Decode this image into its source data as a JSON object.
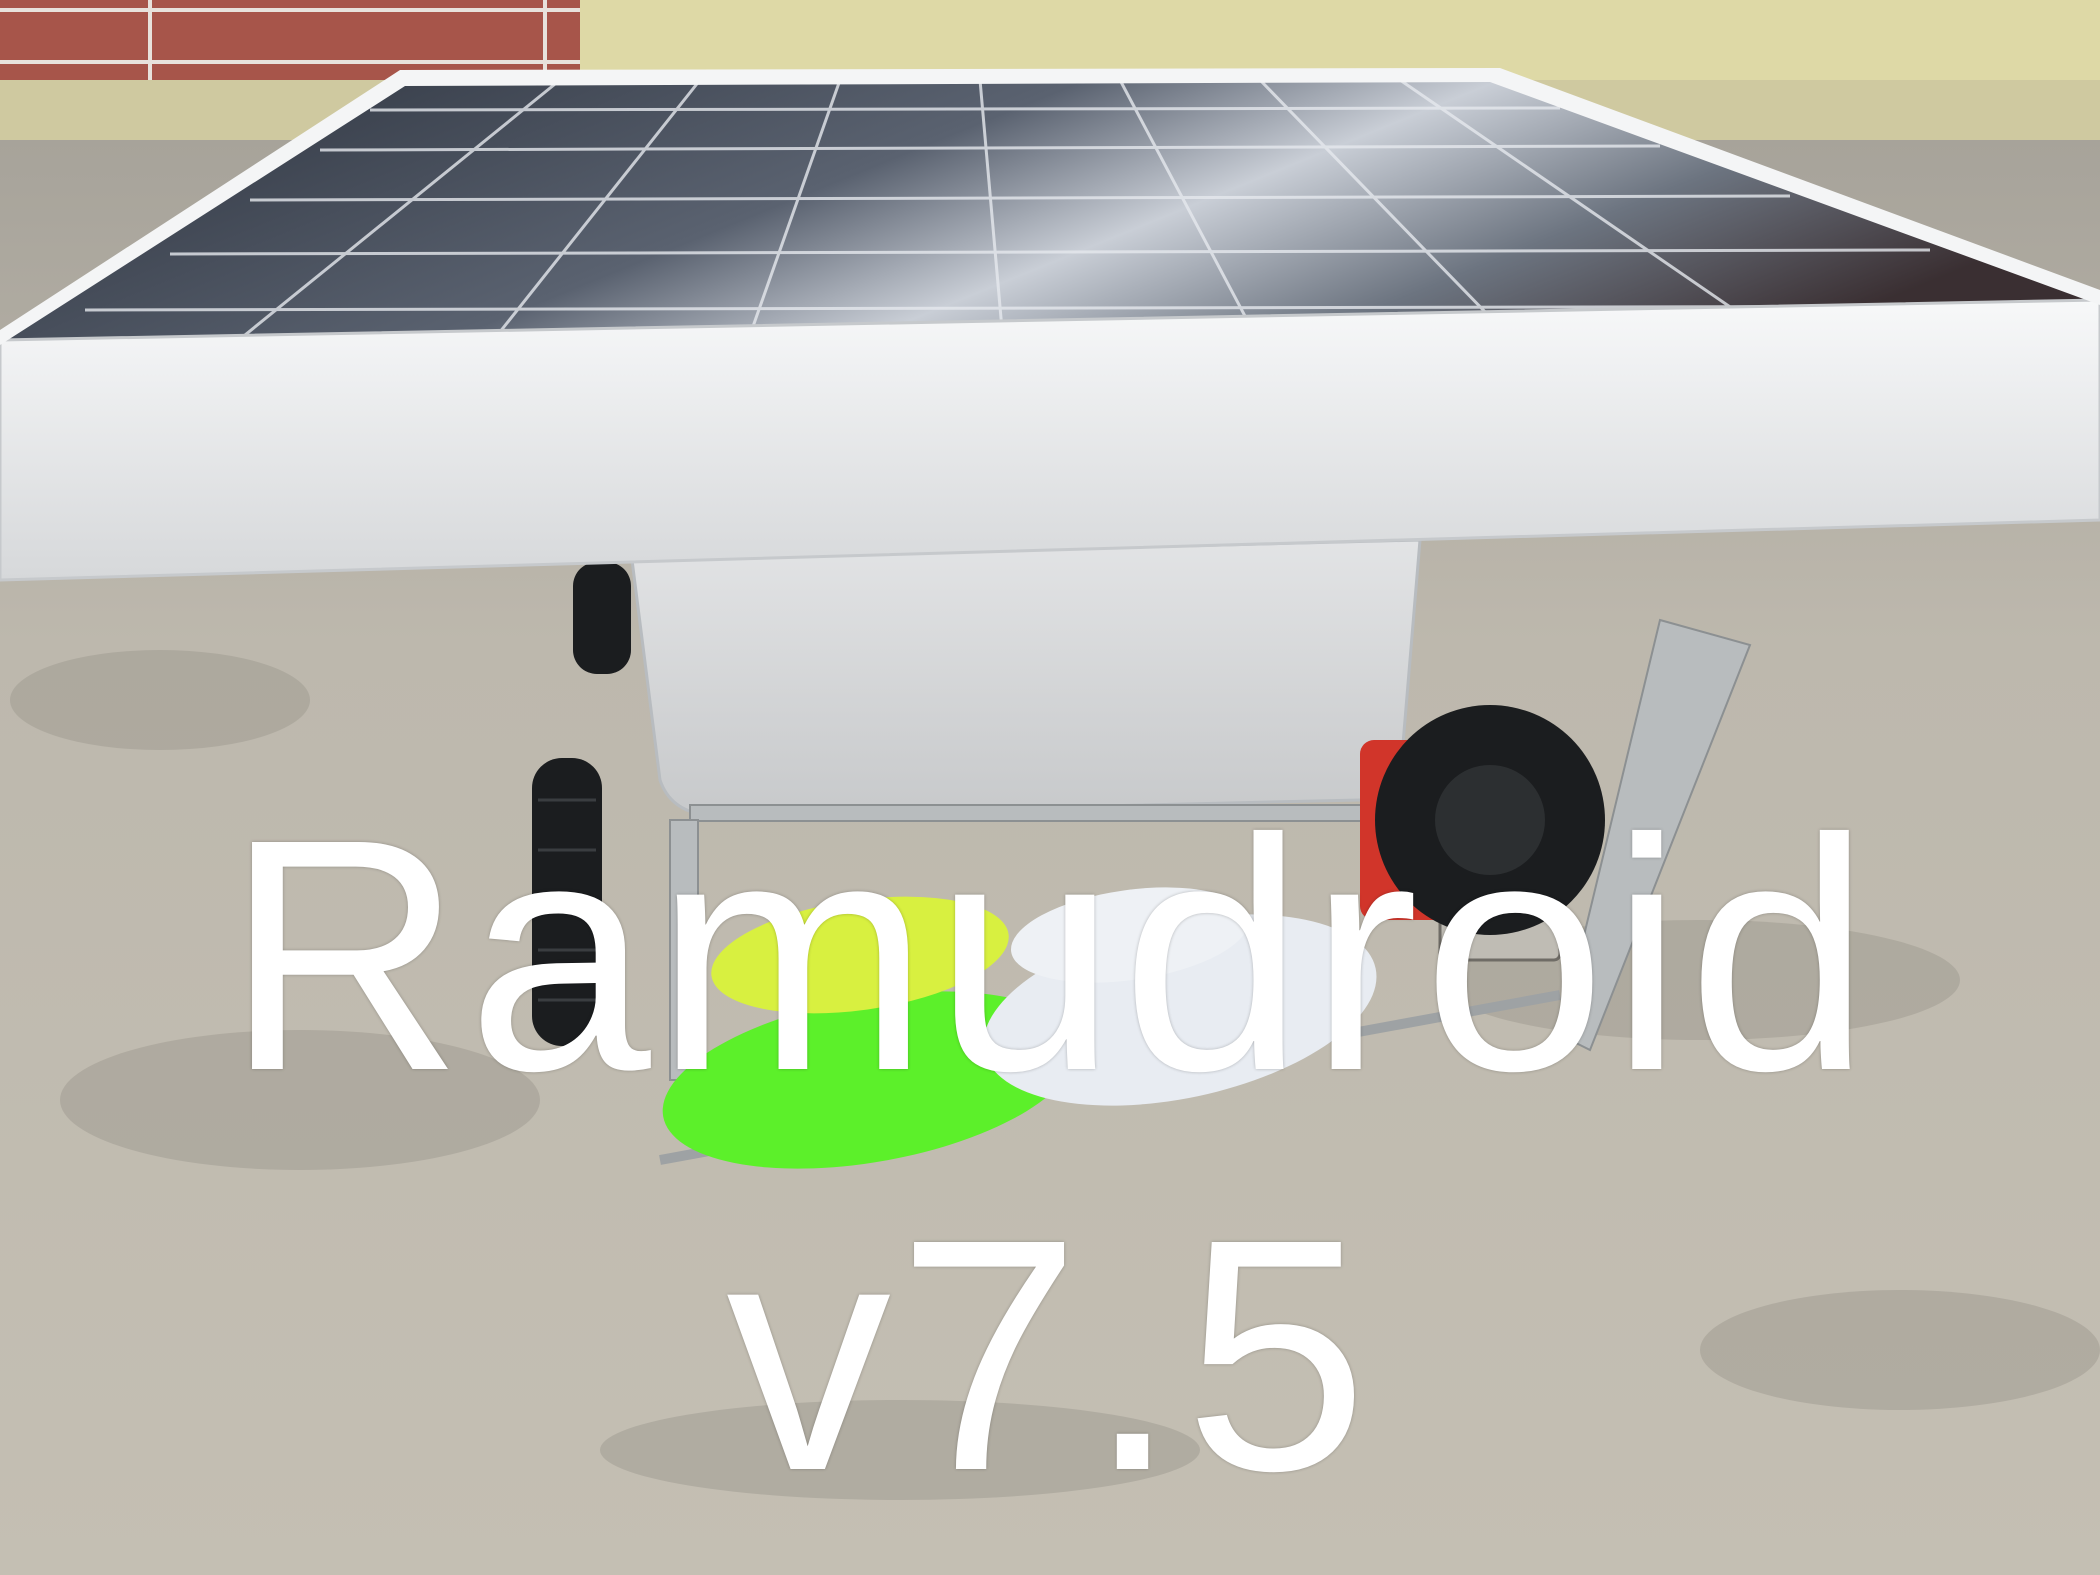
{
  "caption": {
    "line1": "Ramudroid",
    "line2": "v7.5"
  },
  "colors": {
    "ground": "#b9b4a8",
    "wall": "#ded9a6",
    "panel_cell": "#1f2530",
    "panel_frame": "#eceef0",
    "brush_green": "#5cf02a",
    "brush_yellow": "#d8f040",
    "brush_white": "#e8ecf2",
    "tire": "#1b1d1f",
    "caption": "#ffffff"
  },
  "image": {
    "subject": "solar-panel-robot",
    "parts": [
      "solar-panel",
      "plastic-container",
      "rotating-brush",
      "wheels",
      "motor",
      "metal-frame"
    ]
  }
}
